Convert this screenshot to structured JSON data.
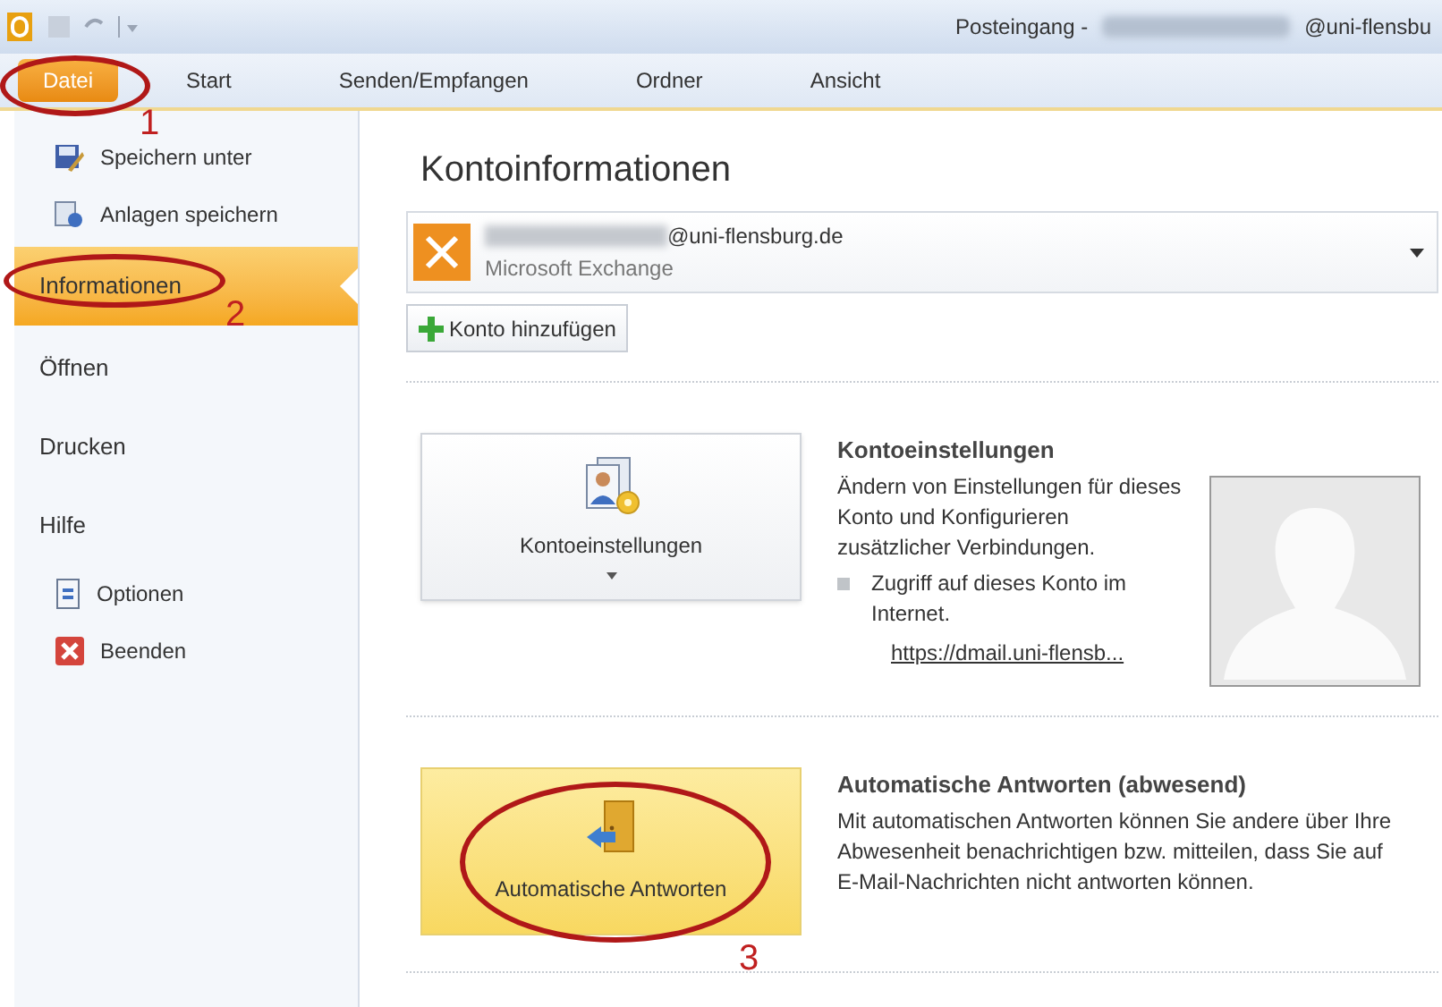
{
  "window": {
    "title": "Posteingang -",
    "title_suffix": "@uni-flensbu"
  },
  "tabs": [
    {
      "label": "Datei",
      "selected": true,
      "annotation": "1"
    },
    {
      "label": "Start",
      "selected": false
    },
    {
      "label": "Senden/Empfangen",
      "selected": false
    },
    {
      "label": "Ordner",
      "selected": false
    },
    {
      "label": "Ansicht",
      "selected": false
    }
  ],
  "sidebar": {
    "items": [
      {
        "label": "Speichern unter",
        "kind": "command",
        "selected": false
      },
      {
        "label": "Anlagen speichern",
        "kind": "command",
        "selected": false
      },
      {
        "label": "Informationen",
        "kind": "page",
        "selected": true,
        "annotation": "2"
      },
      {
        "label": "Öffnen",
        "kind": "page",
        "selected": false
      },
      {
        "label": "Drucken",
        "kind": "page",
        "selected": false
      },
      {
        "label": "Hilfe",
        "kind": "page",
        "selected": false
      },
      {
        "label": "Optionen",
        "kind": "command",
        "selected": false
      },
      {
        "label": "Beenden",
        "kind": "command",
        "selected": false
      }
    ]
  },
  "heading": "Kontoinformationen",
  "account": {
    "email": "@uni-flensburg.de",
    "type": "Microsoft Exchange"
  },
  "add_account": "Konto hinzufügen",
  "sections": [
    {
      "kind": "settings",
      "button": "Kontoeinstellungen",
      "highlighted": false,
      "title": "Kontoeinstellungen",
      "text": "Ändern von Einstellungen für dieses Konto und Konfigurieren zusätzlicher Verbindungen.",
      "bullet": "Zugriff auf dieses Konto im Internet.",
      "link": "https://dmail.uni-flensb..."
    },
    {
      "kind": "autoreply",
      "button": "Automatische Antworten",
      "highlighted": true,
      "annotation": "3",
      "title": "Automatische Antworten (abwesend)",
      "text": "Mit automatischen Antworten können Sie andere über Ihre Abwesenheit benachrichtigen bzw. mitteilen, dass Sie auf E-Mail-Nachrichten nicht antworten können."
    }
  ]
}
